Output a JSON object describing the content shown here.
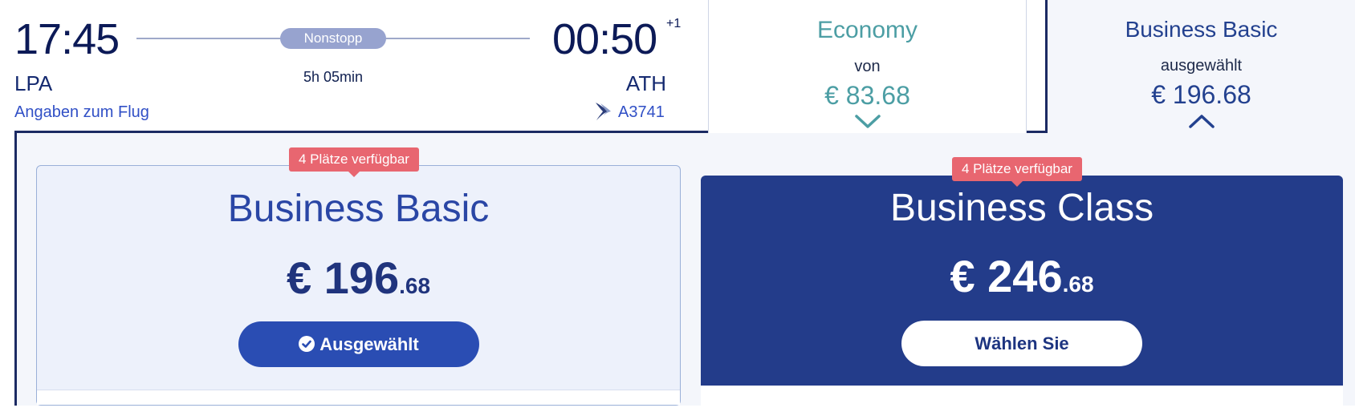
{
  "flight": {
    "departure_time": "17:45",
    "departure_airport": "LPA",
    "arrival_time": "00:50",
    "arrival_day_offset": "+1",
    "arrival_airport": "ATH",
    "stops_label": "Nonstopp",
    "duration": "5h 05min",
    "details_link": "Angaben zum Flug",
    "flight_number": "A3741",
    "airline_icon": "aegean-logo-icon"
  },
  "cabins": {
    "economy": {
      "name": "Economy",
      "sub_label": "von",
      "price": "€ 83.68",
      "chevron_icon": "chevron-down-icon"
    },
    "business": {
      "name": "Business Basic",
      "sub_label": "ausgewählt",
      "price": "€ 196.68",
      "chevron_icon": "chevron-up-icon"
    }
  },
  "fares": [
    {
      "badge": "4 Plätze verfügbar",
      "title": "Business Basic",
      "price_main": "€ 196",
      "price_cents": ".68",
      "button_label": "Ausgewählt",
      "selected": true
    },
    {
      "badge": "4 Plätze verfügbar",
      "title": "Business Class",
      "price_main": "€ 246",
      "price_cents": ".68",
      "button_label": "Wählen Sie",
      "selected": false
    }
  ],
  "colors": {
    "navy": "#1b2a63",
    "economy_teal": "#4c9ea4",
    "business_blue": "#23418f",
    "badge_red": "#e86670",
    "selected_button": "#2a4db3"
  }
}
